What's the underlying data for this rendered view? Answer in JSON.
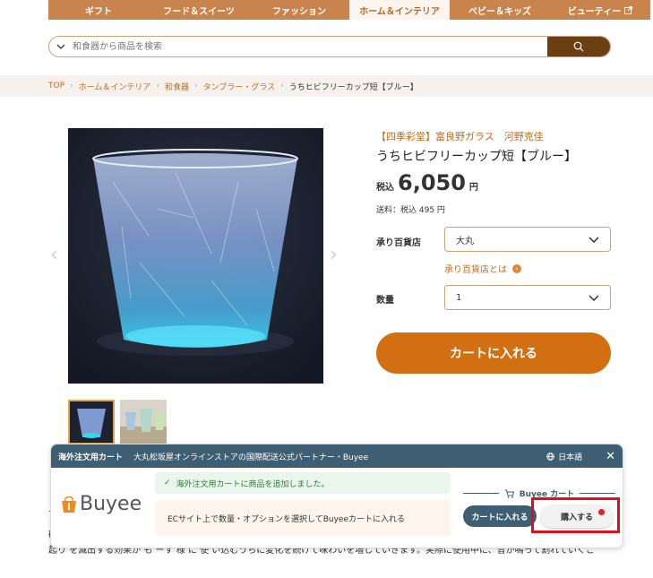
{
  "nav": {
    "tabs": [
      "ギフト",
      "フード＆スイーツ",
      "ファッション",
      "ホーム＆インテリア",
      "ベビー＆キッズ",
      "ビューティー"
    ],
    "active_index": 3
  },
  "search": {
    "placeholder": "和食器から商品を検索"
  },
  "breadcrumb": [
    "TOP",
    "ホーム＆インテリア",
    "和食器",
    "タンブラー・グラス",
    "うちヒビフリーカップ短【ブルー】"
  ],
  "product": {
    "brand": "【四季彩堂】富良野ガラス　河野克佳",
    "title": "うちヒビフリーカップ短【ブルー】",
    "tax_label": "税込",
    "price": "6,050",
    "currency": "円",
    "shipping": "送料：税込 495 円",
    "store_label": "承り百貨店",
    "store_value": "大丸",
    "store_link": "承り百貨店とは",
    "qty_label": "数量",
    "qty_value": "1",
    "cart_button": "カートに入れる"
  },
  "background_text": [
    "イ",
    "碌",
    "起り を滅出する効果が も ーす  様 に 使 い込むうちに変化を続けて味わいを増していきます。実際に使用中に、音が鳴って割れていくこです。"
  ],
  "overlay": {
    "header_title": "海外注文用カート",
    "header_desc": "大丸松坂屋オンラインストアの国際配送公式パートナー・Buyee",
    "lang": "日本語",
    "logo_text": "Buyee",
    "notice": "海外注文用カートに商品を追加しました。",
    "hint": "ECサイト上で数量・オプションを選択してBuyeeカートに入れる",
    "cart_title": "Buyee カート",
    "cart_button": "カートに入れる",
    "buy_button": "購入する"
  },
  "colors": {
    "nav_bg": "#c8844c",
    "accent": "#d26f12",
    "buyee_dark": "#3e5f73",
    "highlight": "#e0101a"
  }
}
